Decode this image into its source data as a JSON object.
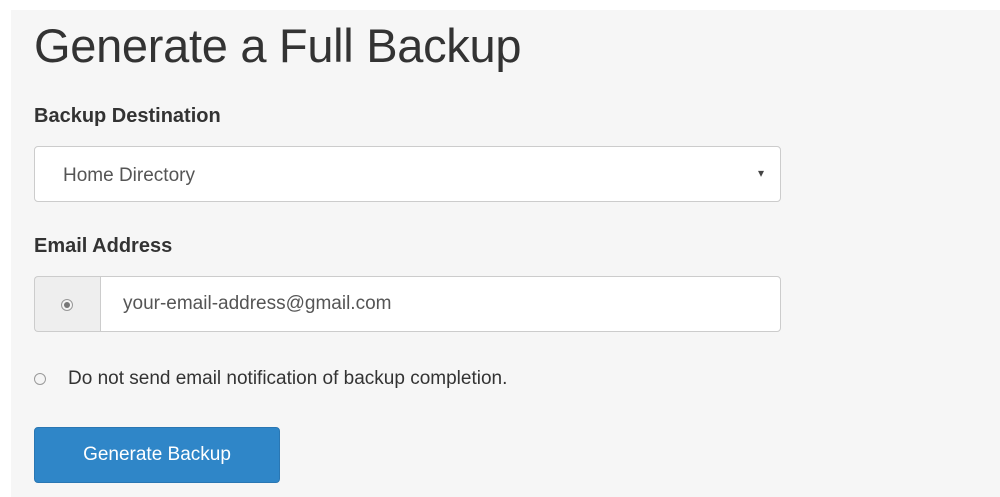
{
  "page": {
    "title": "Generate a Full Backup"
  },
  "backup_destination": {
    "label": "Backup Destination",
    "selected": "Home Directory",
    "caret": "▾"
  },
  "email": {
    "label": "Email Address",
    "value": "your-email-address@gmail.com",
    "send_radio_selected": true
  },
  "no_email_option": {
    "label": "Do not send email notification of backup completion.",
    "selected": false
  },
  "actions": {
    "generate_label": "Generate Backup"
  },
  "colors": {
    "panel_background": "#f6f6f6",
    "primary_button": "#2f86c8",
    "text": "#333333",
    "input_border": "#cccccc"
  }
}
